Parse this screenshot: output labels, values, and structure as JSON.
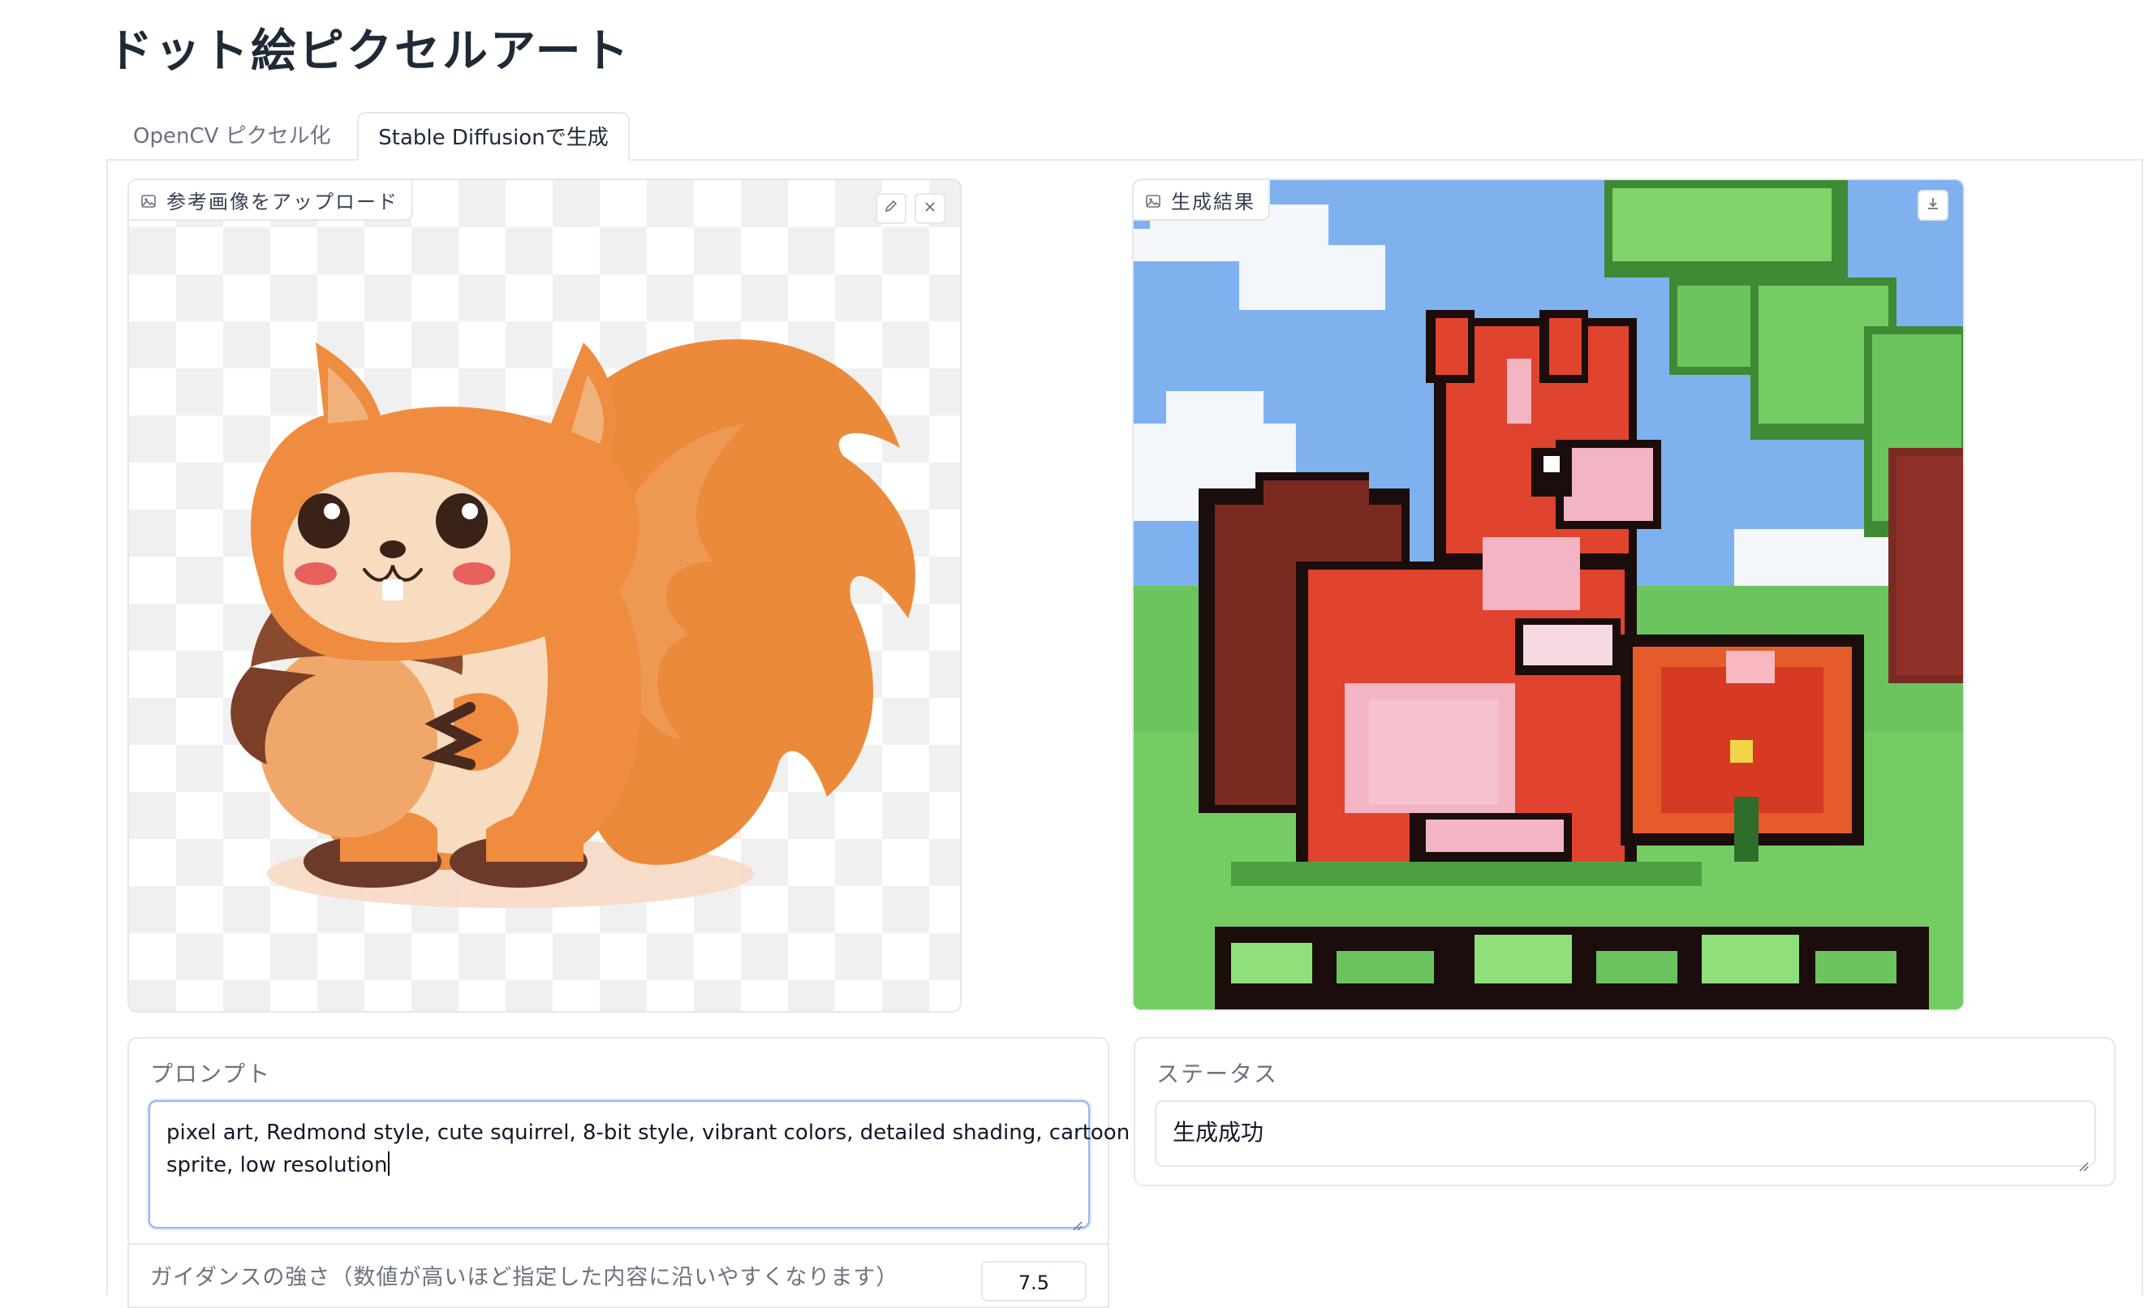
{
  "page": {
    "title": "ドット絵ピクセルアート"
  },
  "tabs": [
    {
      "label": "OpenCV ピクセル化",
      "active": false
    },
    {
      "label": "Stable Diffusionで生成",
      "active": true
    }
  ],
  "reference_image": {
    "label": "参考画像をアップロード",
    "image_icon": "image-icon",
    "edit_icon": "pencil-icon",
    "clear_icon": "close-icon"
  },
  "result_image": {
    "label": "生成結果",
    "image_icon": "image-icon",
    "download_icon": "download-icon"
  },
  "prompt": {
    "label": "プロンプト",
    "line1": "pixel art, Redmond style, cute squirrel, 8-bit style, vibrant colors, detailed shading, cartoon",
    "line2": "sprite, low resolution"
  },
  "status": {
    "label": "ステータス",
    "value": "生成成功"
  },
  "guidance": {
    "label": "ガイダンスの強さ（数値が高いほど指定した内容に沿いやすくなります）",
    "value": "7.5"
  },
  "colors": {
    "accent_focus": "#93b4f5",
    "border": "#e5e7eb"
  }
}
